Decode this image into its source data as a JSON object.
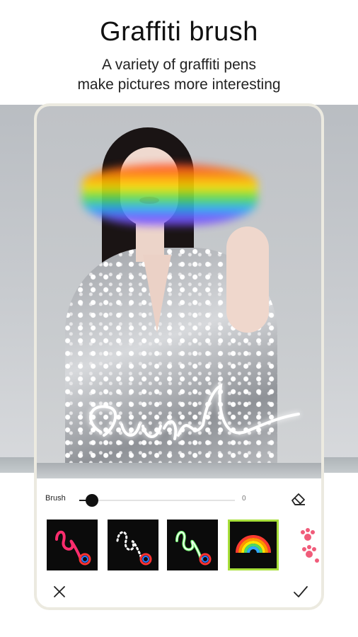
{
  "header": {
    "title": "Graffiti brush",
    "subtitle_line1": "A variety of graffiti pens",
    "subtitle_line2": "make pictures more interesting"
  },
  "editor": {
    "brush_label": "Brush",
    "brush_size": 0,
    "brush_size_max": 100,
    "eraser_icon": "eraser-icon",
    "brushes": [
      {
        "name": "pink-squiggle-brush",
        "selected": false
      },
      {
        "name": "dotted-white-brush",
        "selected": false
      },
      {
        "name": "neon-green-brush",
        "selected": false
      },
      {
        "name": "rainbow-brush",
        "selected": true
      },
      {
        "name": "paw-print-brush",
        "selected": false
      }
    ],
    "cancel_icon": "close-icon",
    "confirm_icon": "check-icon",
    "accent_color": "#a7df3a"
  }
}
